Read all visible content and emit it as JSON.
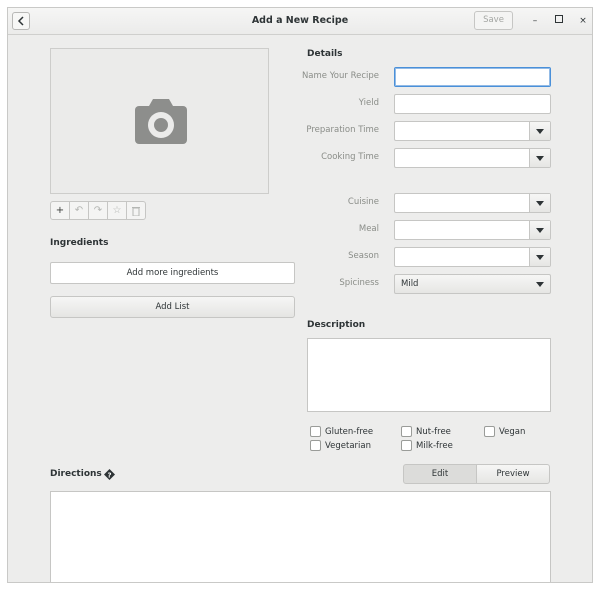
{
  "window": {
    "title": "Add a New Recipe",
    "save_label": "Save",
    "controls": {
      "minimize": "–",
      "maximize": "□",
      "close": "×"
    }
  },
  "photo": {
    "icon": "camera-icon"
  },
  "photo_toolbar": [
    {
      "name": "add-photo",
      "glyph": "+"
    },
    {
      "name": "rotate-left",
      "glyph": "↶"
    },
    {
      "name": "rotate-right",
      "glyph": "↷"
    },
    {
      "name": "favorite",
      "glyph": "☆"
    },
    {
      "name": "delete-photo",
      "glyph": "🗑"
    }
  ],
  "ingredients": {
    "heading": "Ingredients",
    "add_more_label": "Add more ingredients",
    "add_list_label": "Add List"
  },
  "details": {
    "heading": "Details",
    "name_label": "Name Your Recipe",
    "yield_label": "Yield",
    "prep_label": "Preparation Time",
    "cooking_label": "Cooking Time",
    "cuisine_label": "Cuisine",
    "meal_label": "Meal",
    "season_label": "Season",
    "spiciness_label": "Spiciness",
    "spiciness_value": "Mild"
  },
  "description": {
    "heading": "Description"
  },
  "dietary": {
    "gluten_free": "Gluten-free",
    "nut_free": "Nut-free",
    "vegan": "Vegan",
    "vegetarian": "Vegetarian",
    "milk_free": "Milk-free"
  },
  "directions": {
    "heading": "Directions",
    "help_icon": "question-diamond-icon",
    "edit_label": "Edit",
    "preview_label": "Preview"
  },
  "colors": {
    "focus": "#4a90d9",
    "window_bg": "#ededec"
  }
}
